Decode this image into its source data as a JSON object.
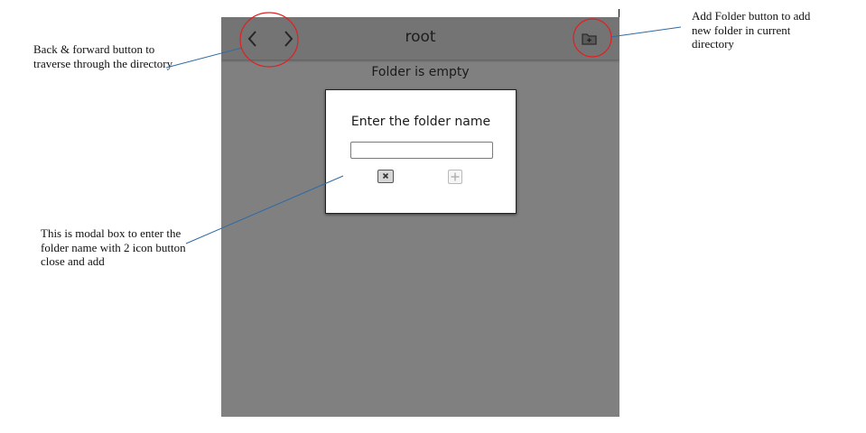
{
  "annotations": {
    "nav_note": "Back & forward button to traverse through the directory",
    "modal_note": "This is modal box to enter the folder name with 2 icon button close and add",
    "add_folder_note": "Add Folder button to add new folder in current directory",
    "callout_color": "#e02020",
    "line_color": "#2f6aa6"
  },
  "app": {
    "title": "root",
    "empty_message": "Folder is empty",
    "back_icon": "chevron-left-icon",
    "forward_icon": "chevron-right-icon",
    "add_folder_icon": "folder-plus-icon"
  },
  "modal": {
    "title": "Enter the folder name",
    "input_value": "",
    "input_placeholder": "",
    "close_icon": "close-icon",
    "add_icon": "plus-icon"
  }
}
